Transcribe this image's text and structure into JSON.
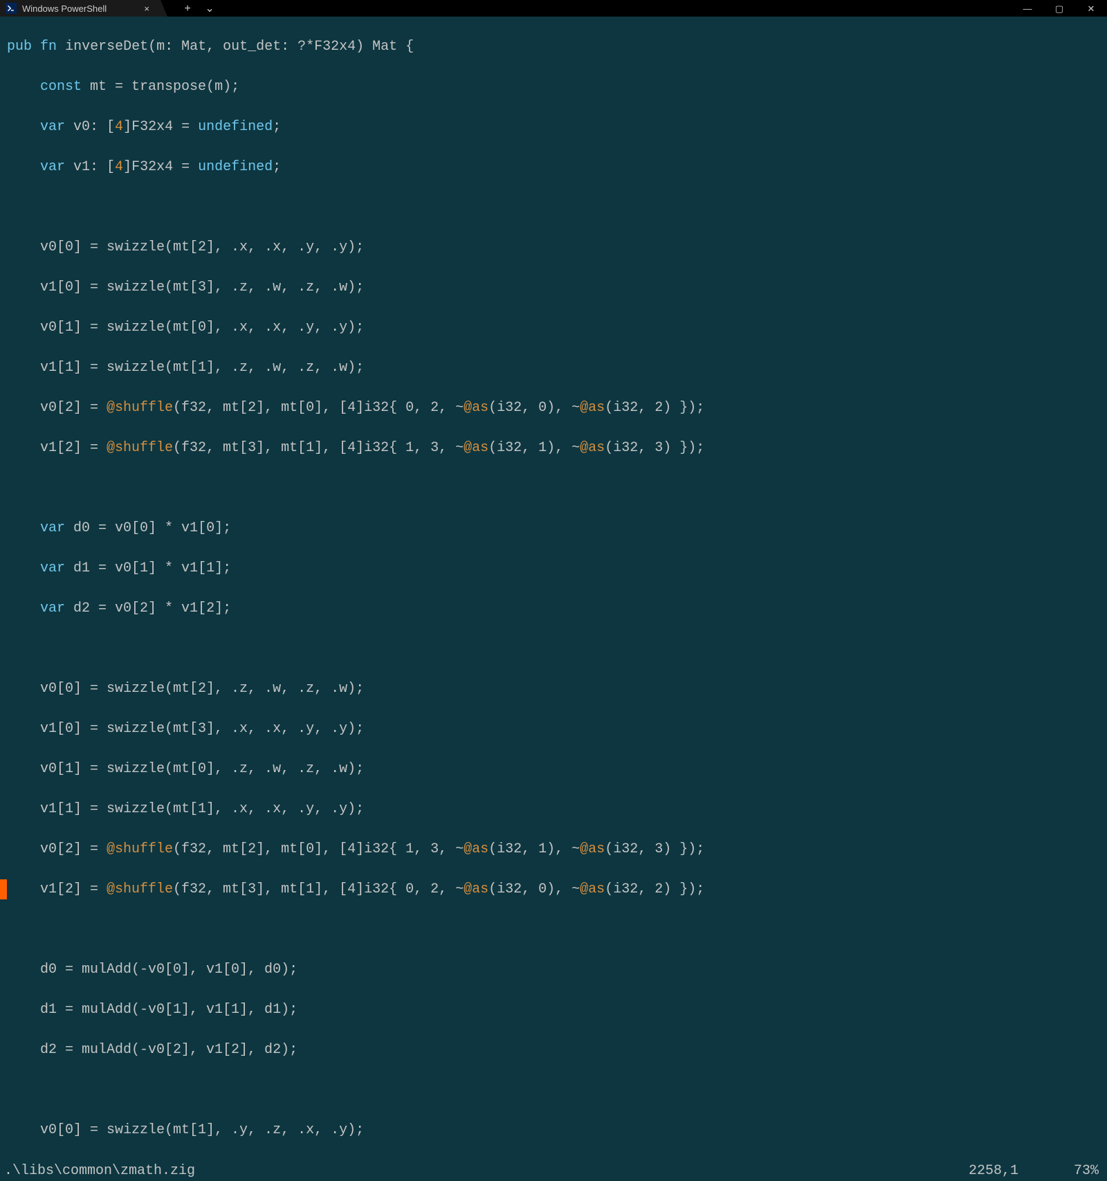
{
  "window": {
    "tab_title": "Windows PowerShell",
    "actions": {
      "new_tab": "+",
      "dropdown": "⌄"
    },
    "controls": {
      "min": "—",
      "max": "▢",
      "close": "✕"
    }
  },
  "code": {
    "l01": {
      "kw1": "pub",
      "kw2": "fn",
      "name": "inverseDet",
      "sig": "(m: Mat, out_det: ?*F32x4) Mat {"
    },
    "l02": {
      "kw": "const",
      "rest": " mt = transpose(m);"
    },
    "l03": {
      "kw": "var",
      "rest": " v0: [",
      "n": "4",
      "rest2": "]F32x4 = ",
      "u": "undefined",
      "semi": ";"
    },
    "l04": {
      "kw": "var",
      "rest": " v1: [",
      "n": "4",
      "rest2": "]F32x4 = ",
      "u": "undefined",
      "semi": ";"
    },
    "l06": "    v0[0] = swizzle(mt[2], .x, .x, .y, .y);",
    "l07": "    v1[0] = swizzle(mt[3], .z, .w, .z, .w);",
    "l08": "    v0[1] = swizzle(mt[0], .x, .x, .y, .y);",
    "l09": "    v1[1] = swizzle(mt[1], .z, .w, .z, .w);",
    "l10a": "    v0[2] = ",
    "l10b": "@shuffle",
    "l10c": "(f32, mt[2], mt[0], [4]i32{ 0, 2, ~",
    "l10d": "@as",
    "l10e": "(i32, 0), ~",
    "l10f": "@as",
    "l10g": "(i32, 2) });",
    "l11a": "    v1[2] = ",
    "l11b": "@shuffle",
    "l11c": "(f32, mt[3], mt[1], [4]i32{ 1, 3, ~",
    "l11d": "@as",
    "l11e": "(i32, 1), ~",
    "l11f": "@as",
    "l11g": "(i32, 3) });",
    "l13": {
      "kw": "var",
      "rest": " d0 = v0[0] * v1[0];"
    },
    "l14": {
      "kw": "var",
      "rest": " d1 = v0[1] * v1[1];"
    },
    "l15": {
      "kw": "var",
      "rest": " d2 = v0[2] * v1[2];"
    },
    "l17": "    v0[0] = swizzle(mt[2], .z, .w, .z, .w);",
    "l18": "    v1[0] = swizzle(mt[3], .x, .x, .y, .y);",
    "l19": "    v0[1] = swizzle(mt[0], .z, .w, .z, .w);",
    "l20": "    v1[1] = swizzle(mt[1], .x, .x, .y, .y);",
    "l21a": "    v0[2] = ",
    "l21b": "@shuffle",
    "l21c": "(f32, mt[2], mt[0], [4]i32{ 1, 3, ~",
    "l21d": "@as",
    "l21e": "(i32, 1), ~",
    "l21f": "@as",
    "l21g": "(i32, 3) });",
    "l22a": "    v1[2] = ",
    "l22b": "@shuffle",
    "l22c": "(f32, mt[3], mt[1], [4]i32{ 0, 2, ~",
    "l22d": "@as",
    "l22e": "(i32, 0), ~",
    "l22f": "@as",
    "l22g": "(i32, 2) });",
    "l24": "    d0 = mulAdd(-v0[0], v1[0], d0);",
    "l25": "    d1 = mulAdd(-v0[1], v1[1], d1);",
    "l26": "    d2 = mulAdd(-v0[2], v1[2], d2);",
    "l28": "    v0[0] = swizzle(mt[1], .y, .z, .x, .y);"
  },
  "statusbar": {
    "file": ".\\libs\\common\\zmath.zig",
    "pos": "2258,1",
    "percent": "73%"
  },
  "gutter_marks": {
    "line_index_marked": 21
  }
}
